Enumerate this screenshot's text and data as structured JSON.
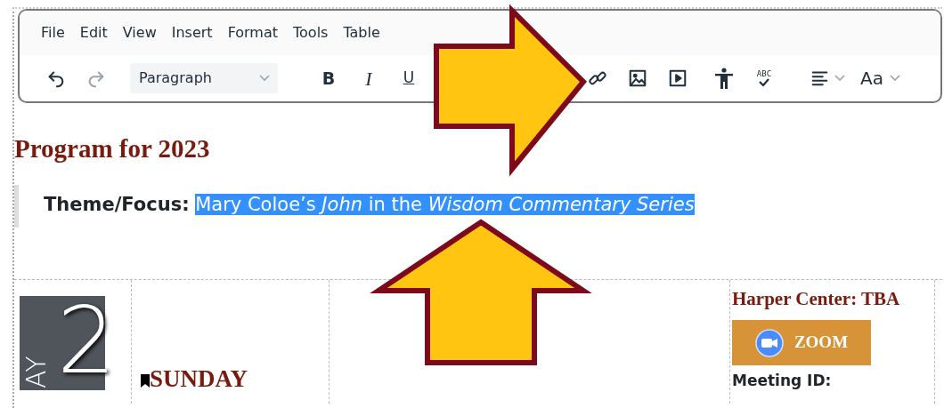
{
  "menu": [
    "File",
    "Edit",
    "View",
    "Insert",
    "Format",
    "Tools",
    "Table"
  ],
  "toolbar": [
    {
      "kind": "undo",
      "disabled": false
    },
    {
      "kind": "redo",
      "disabled": true
    },
    {
      "kind": "select",
      "label": "Paragraph"
    },
    {
      "kind": "bold",
      "label": "B"
    },
    {
      "kind": "italic",
      "label": "I"
    },
    {
      "kind": "underline",
      "label": "U"
    },
    {
      "kind": "link"
    },
    {
      "kind": "image"
    },
    {
      "kind": "media"
    },
    {
      "kind": "accessibility"
    },
    {
      "kind": "spellcheck",
      "label": "ABC"
    },
    {
      "kind": "align"
    },
    {
      "kind": "font",
      "label": "Aa"
    }
  ],
  "content": {
    "heading": "Program for 2023",
    "theme": {
      "label": "Theme/Focus:",
      "text": "Mary Coloe’s *John* in the *Wisdom Commentary Series*",
      "selected": true
    }
  },
  "schedule": {
    "day_label": "AY",
    "day_number": "2",
    "day_name": "SUNDAY",
    "location": "Harper Center: TBA",
    "zoom_button": "ZOOM",
    "meeting_id": "Meeting ID:"
  }
}
